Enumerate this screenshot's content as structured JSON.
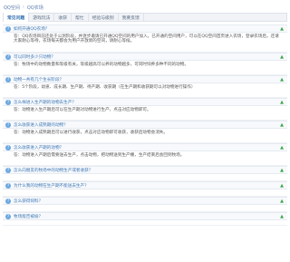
{
  "breadcrumb": [
    "QQ空间",
    "QQ农场"
  ],
  "tabs": [
    {
      "label": "常见问题",
      "active": true
    },
    {
      "label": "游戏玩法",
      "active": false
    },
    {
      "label": "收获",
      "active": false
    },
    {
      "label": "帮忙",
      "active": false
    },
    {
      "label": "经验与级别",
      "active": false
    },
    {
      "label": "我要反馈",
      "active": false
    }
  ],
  "faq": [
    {
      "question": "如何开通QQ农场？",
      "answer": "答：QQ农场目前还处于公测阶段，并逐步邀请已开通QQ空间的用户加入。已开通的空间用户，可以在QQ空间首页进入农场，登录农场后，还请大家耐心等待，农场每天都会为用户开放新的空间，请耐心等候。"
    },
    {
      "question": "可以同时多少只动物？",
      "answer": "答：牧场中的动物数量和等级有关，等级越高可以养的动物越多，可同时饲养多种不同的动物。"
    },
    {
      "question": "动物一共有几个生长阶段？",
      "answer": "答：5个阶段，幼崽、成长期、生产期、待产期、收获期（在生产期和收获期可以对动物进行操作）"
    },
    {
      "question": "怎么样进入生产期的动物去生产？",
      "answer": "答：动物进入生产期后可以在生产期对动物进行生产，点击对应动物即可。"
    },
    {
      "question": "怎么收获进入成熟期的动物？",
      "answer": "答：动物进入成熟期后可以进行收获，点击对应动物即可收获，收获后动物会消失。"
    },
    {
      "question": "怎么收获进入产期的动物？",
      "answer": "答：动物进入产期后需要送去生产，点击动物，把动物送到生产棚，生产结束后会回到牧场。"
    },
    {
      "question": "怎么向朋友的牧场中的动物生产或者收获？",
      "answer": ""
    },
    {
      "question": "为什么我的动物在生产期不能送去生产？",
      "answer": ""
    },
    {
      "question": "怎么获得饲料？",
      "answer": ""
    },
    {
      "question": "牧场能否被偷？",
      "answer": ""
    }
  ],
  "icons": {
    "question": "question-icon",
    "toggle": "up-arrow-icon"
  }
}
